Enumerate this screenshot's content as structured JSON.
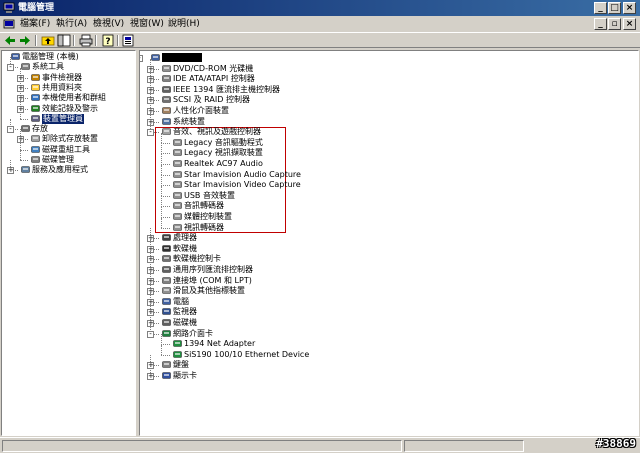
{
  "window": {
    "title": "電腦管理"
  },
  "menu": [
    "檔案(F)",
    "執行(A)",
    "檢視(V)",
    "視窗(W)",
    "說明(H)"
  ],
  "left_tree": [
    {
      "label": "電腦管理 (本機)",
      "level": 0,
      "icon": "computer-management-icon",
      "exp": ""
    },
    {
      "label": "系統工具",
      "level": 1,
      "icon": "tools-icon",
      "exp": "-"
    },
    {
      "label": "事件檢視器",
      "level": 2,
      "icon": "event-viewer-icon",
      "exp": "+"
    },
    {
      "label": "共用資料夾",
      "level": 2,
      "icon": "shared-folder-icon",
      "exp": "+"
    },
    {
      "label": "本機使用者和群組",
      "level": 2,
      "icon": "users-icon",
      "exp": "+"
    },
    {
      "label": "效能記錄及警示",
      "level": 2,
      "icon": "performance-icon",
      "exp": "+"
    },
    {
      "label": "裝置管理員",
      "level": 2,
      "icon": "device-manager-icon",
      "exp": "",
      "selected": true
    },
    {
      "label": "存放",
      "level": 1,
      "icon": "storage-icon",
      "exp": "-"
    },
    {
      "label": "卸除式存放裝置",
      "level": 2,
      "icon": "removable-storage-icon",
      "exp": "+"
    },
    {
      "label": "磁碟重組工具",
      "level": 2,
      "icon": "defrag-icon",
      "exp": ""
    },
    {
      "label": "磁碟管理",
      "level": 2,
      "icon": "disk-management-icon",
      "exp": ""
    },
    {
      "label": "服務及應用程式",
      "level": 1,
      "icon": "services-icon",
      "exp": "+"
    }
  ],
  "right_tree": [
    {
      "label": "",
      "level": 0,
      "icon": "computer-icon",
      "exp": "-",
      "redacted": true
    },
    {
      "label": "DVD/CD-ROM 光碟機",
      "level": 1,
      "icon": "dvd-icon",
      "exp": "+"
    },
    {
      "label": "IDE ATA/ATAPI 控制器",
      "level": 1,
      "icon": "ide-controller-icon",
      "exp": "+"
    },
    {
      "label": "IEEE 1394 匯流排主機控制器",
      "level": 1,
      "icon": "ieee1394-icon",
      "exp": "+"
    },
    {
      "label": "SCSI 及 RAID 控制器",
      "level": 1,
      "icon": "scsi-icon",
      "exp": "+"
    },
    {
      "label": "人性化介面裝置",
      "level": 1,
      "icon": "hid-icon",
      "exp": "+"
    },
    {
      "label": "系統裝置",
      "level": 1,
      "icon": "system-device-icon",
      "exp": "+"
    },
    {
      "label": "音效、視訊及遊戲控制器",
      "level": 1,
      "icon": "sound-icon",
      "exp": "-"
    },
    {
      "label": "Legacy 音訊驅動程式",
      "level": 2,
      "icon": "sound-device-icon",
      "exp": ""
    },
    {
      "label": "Legacy 視訊擷取裝置",
      "level": 2,
      "icon": "sound-device-icon",
      "exp": ""
    },
    {
      "label": "Realtek AC97 Audio",
      "level": 2,
      "icon": "sound-device-icon",
      "exp": ""
    },
    {
      "label": "Star Imavision Audio Capture",
      "level": 2,
      "icon": "sound-device-icon",
      "exp": ""
    },
    {
      "label": "Star Imavision Video Capture",
      "level": 2,
      "icon": "sound-device-icon",
      "exp": ""
    },
    {
      "label": "USB 音效裝置",
      "level": 2,
      "icon": "sound-device-icon",
      "exp": ""
    },
    {
      "label": "音訊轉碼器",
      "level": 2,
      "icon": "sound-device-icon",
      "exp": ""
    },
    {
      "label": "媒體控制裝置",
      "level": 2,
      "icon": "sound-device-icon",
      "exp": ""
    },
    {
      "label": "視訊轉碼器",
      "level": 2,
      "icon": "sound-device-icon",
      "exp": ""
    },
    {
      "label": "處理器",
      "level": 1,
      "icon": "processor-icon",
      "exp": "+"
    },
    {
      "label": "軟碟機",
      "level": 1,
      "icon": "floppy-icon",
      "exp": "+"
    },
    {
      "label": "軟碟機控制卡",
      "level": 1,
      "icon": "floppy-controller-icon",
      "exp": "+"
    },
    {
      "label": "通用序列匯流排控制器",
      "level": 1,
      "icon": "usb-icon",
      "exp": "+"
    },
    {
      "label": "連接埠 (COM 和 LPT)",
      "level": 1,
      "icon": "port-icon",
      "exp": "+"
    },
    {
      "label": "滑鼠及其他指標裝置",
      "level": 1,
      "icon": "mouse-icon",
      "exp": "+"
    },
    {
      "label": "電腦",
      "level": 1,
      "icon": "computer-icon",
      "exp": "+"
    },
    {
      "label": "監視器",
      "level": 1,
      "icon": "monitor-icon",
      "exp": "+"
    },
    {
      "label": "磁碟機",
      "level": 1,
      "icon": "disk-icon",
      "exp": "+"
    },
    {
      "label": "網路介面卡",
      "level": 1,
      "icon": "network-icon",
      "exp": "-"
    },
    {
      "label": "1394 Net Adapter",
      "level": 2,
      "icon": "network-adapter-icon",
      "exp": ""
    },
    {
      "label": "SiS190 100/10 Ethernet Device",
      "level": 2,
      "icon": "network-adapter-icon",
      "exp": ""
    },
    {
      "label": "鍵盤",
      "level": 1,
      "icon": "keyboard-icon",
      "exp": "+"
    },
    {
      "label": "顯示卡",
      "level": 1,
      "icon": "display-icon",
      "exp": "+"
    }
  ],
  "watermark": "#38869",
  "colors": {
    "title_start": "#0a246a",
    "title_end": "#3a6ea5",
    "highlight_border": "#c00000",
    "selection": "#0a246a"
  }
}
